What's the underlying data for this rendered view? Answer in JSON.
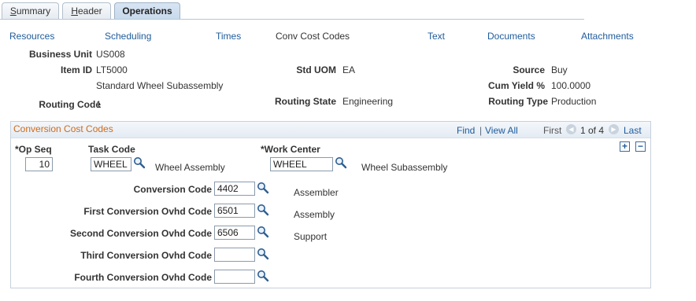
{
  "tabs": [
    {
      "label": "Summary",
      "underline": "S"
    },
    {
      "label": "Header",
      "underline": "H"
    },
    {
      "label": "Operations",
      "active": true
    }
  ],
  "links": {
    "resources": "Resources",
    "scheduling": "Scheduling",
    "times": "Times",
    "conv_cost_codes": "Conv Cost Codes",
    "text": "Text",
    "documents": "Documents",
    "attachments": "Attachments"
  },
  "header": {
    "business_unit_label": "Business Unit",
    "business_unit": "US008",
    "item_id_label": "Item ID",
    "item_id": "LT5000",
    "item_desc": "Standard Wheel Subassembly",
    "routing_code_label": "Routing Code",
    "routing_code": "1",
    "std_uom_label": "Std UOM",
    "std_uom": "EA",
    "routing_state_label": "Routing State",
    "routing_state": "Engineering",
    "source_label": "Source",
    "source": "Buy",
    "cum_yield_label": "Cum Yield %",
    "cum_yield": "100.0000",
    "routing_type_label": "Routing Type",
    "routing_type": "Production"
  },
  "group": {
    "title": "Conversion Cost Codes",
    "find": "Find",
    "separator": "|",
    "view_all": "View All",
    "first": "First",
    "pager": "1 of 4",
    "last": "Last",
    "add_symbol": "+",
    "remove_symbol": "−"
  },
  "form": {
    "op_seq_label": "*Op Seq",
    "op_seq": "10",
    "task_code_label": "Task Code",
    "task_code": "WHEEL",
    "task_desc": "Wheel Assembly",
    "work_center_label": "*Work Center",
    "work_center": "WHEEL",
    "work_center_desc": "Wheel Subassembly",
    "conversion_code_label": "Conversion Code",
    "conversion_code": "4402",
    "conversion_desc": "Assembler",
    "first_ovhd_label": "First Conversion Ovhd Code",
    "first_ovhd": "6501",
    "first_ovhd_desc": "Assembly",
    "second_ovhd_label": "Second Conversion Ovhd Code",
    "second_ovhd": "6506",
    "second_ovhd_desc": "Support",
    "third_ovhd_label": "Third Conversion Ovhd Code",
    "third_ovhd": "",
    "fourth_ovhd_label": "Fourth Conversion Ovhd Code",
    "fourth_ovhd": ""
  },
  "icons": {
    "lookup": "magnifier-icon",
    "prev": "arrow-left-icon",
    "next": "arrow-right-icon"
  },
  "colors": {
    "link": "#1f5b9c",
    "group_title": "#d06a1a"
  }
}
